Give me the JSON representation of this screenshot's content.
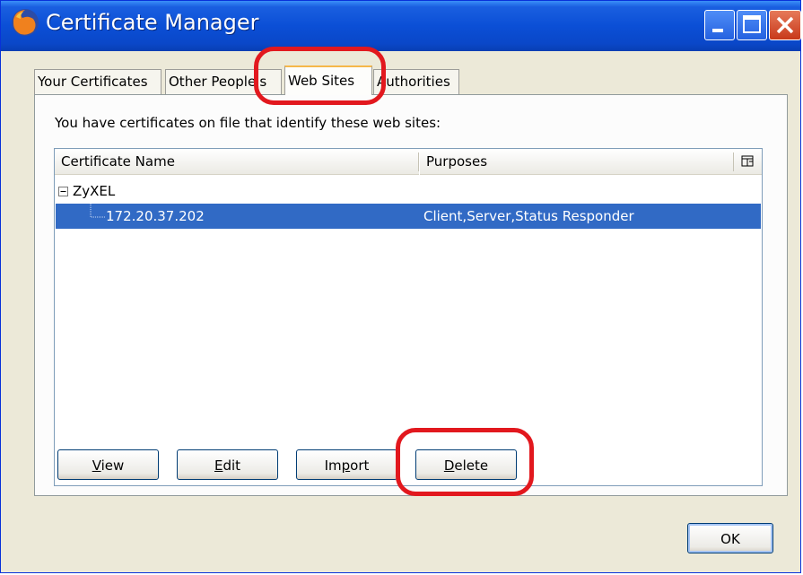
{
  "window": {
    "title": "Certificate Manager"
  },
  "tabs": [
    {
      "label": "Your Certificates",
      "active": false
    },
    {
      "label": "Other People's",
      "active": false
    },
    {
      "label": "Web Sites",
      "active": true
    },
    {
      "label": "Authorities",
      "active": false
    }
  ],
  "panel": {
    "description": "You have certificates on file that identify these web sites:"
  },
  "tree": {
    "columns": [
      "Certificate Name",
      "Purposes"
    ],
    "groups": [
      {
        "name": "ZyXEL",
        "expanded": true,
        "items": [
          {
            "name": "172.20.37.202",
            "purposes": "Client,Server,Status Responder",
            "selected": true
          }
        ]
      }
    ]
  },
  "buttons": {
    "view": {
      "mnemonic": "V",
      "rest": "iew"
    },
    "edit": {
      "mnemonic": "E",
      "rest": "dit"
    },
    "import": {
      "pre": "Im",
      "mnemonic": "p",
      "rest": "ort"
    },
    "delete": {
      "mnemonic": "D",
      "rest": "elete"
    },
    "ok": "OK"
  },
  "colors": {
    "title_bar": "#0b4fd6",
    "selection": "#316ac5",
    "highlight_annotation": "#e2181e",
    "dialog_bg": "#ece9d8"
  }
}
